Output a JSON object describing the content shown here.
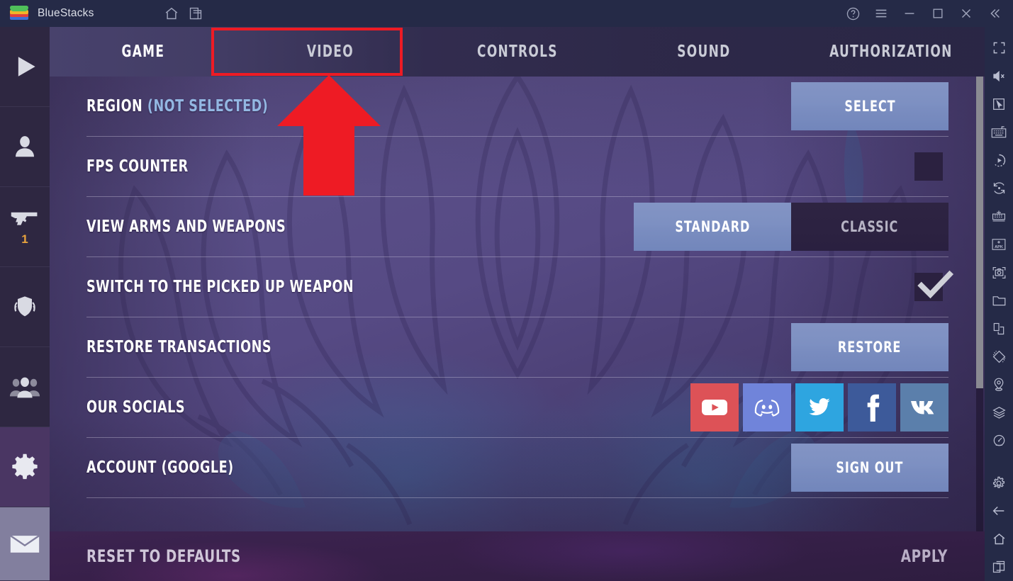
{
  "titlebar": {
    "app_name": "BlueStacks",
    "logo_icon": "bluestacks-logo",
    "left_icons": [
      {
        "name": "home-icon",
        "label": "Home"
      },
      {
        "name": "multi-instance-icon",
        "label": "Instance Manager"
      }
    ],
    "right_icons": [
      {
        "name": "help-icon",
        "label": "Help"
      },
      {
        "name": "menu-icon",
        "label": "Menu"
      },
      {
        "name": "minimize-icon",
        "label": "Minimize"
      },
      {
        "name": "maximize-icon",
        "label": "Maximize"
      },
      {
        "name": "close-icon",
        "label": "Close"
      },
      {
        "name": "collapse-icon",
        "label": "Collapse"
      }
    ]
  },
  "left_rail": {
    "items": [
      {
        "name": "play-icon",
        "label": "Play",
        "active": false,
        "badge": ""
      },
      {
        "name": "profile-icon",
        "label": "Profile",
        "active": false,
        "badge": ""
      },
      {
        "name": "weapons-icon",
        "label": "Weapons",
        "active": false,
        "badge": "1"
      },
      {
        "name": "clan-icon",
        "label": "Clan",
        "active": false,
        "badge": ""
      },
      {
        "name": "friends-icon",
        "label": "Friends",
        "active": false,
        "badge": ""
      },
      {
        "name": "settings-gear-icon",
        "label": "Settings",
        "active": true,
        "badge": ""
      },
      {
        "name": "mail-icon",
        "label": "Mail",
        "active": false,
        "badge": ""
      }
    ]
  },
  "right_rail": {
    "items": [
      {
        "name": "fullscreen-icon",
        "label": "Full screen"
      },
      {
        "name": "mute-icon",
        "label": "Mute"
      },
      {
        "name": "cursor-icon",
        "label": "Pointer"
      },
      {
        "name": "keymapping-icon",
        "label": "Game controls"
      },
      {
        "name": "macro-recorder-icon",
        "label": "Macro recorder"
      },
      {
        "name": "rotate-icon",
        "label": "Rotate"
      },
      {
        "name": "multi-instance-sync-icon",
        "label": "Multi-instance sync"
      },
      {
        "name": "install-apk-icon",
        "label": "Install APK"
      },
      {
        "name": "screenshot-icon",
        "label": "Screenshot"
      },
      {
        "name": "media-folder-icon",
        "label": "Media manager"
      },
      {
        "name": "copy-to-instance-icon",
        "label": "Copy to instance"
      },
      {
        "name": "tilt-icon",
        "label": "Tilt control"
      },
      {
        "name": "location-icon",
        "label": "Location"
      },
      {
        "name": "layers-icon",
        "label": "Layers"
      },
      {
        "name": "performance-icon",
        "label": "Performance"
      },
      {
        "name": "settings-gear-icon",
        "label": "Settings"
      },
      {
        "name": "back-arrow-icon",
        "label": "Back"
      },
      {
        "name": "home-icon",
        "label": "Home"
      },
      {
        "name": "recent-apps-icon",
        "label": "Recent apps"
      }
    ]
  },
  "tabs": [
    {
      "label": "GAME",
      "active": true,
      "highlighted": false
    },
    {
      "label": "VIDEO",
      "active": false,
      "highlighted": true
    },
    {
      "label": "CONTROLS",
      "active": false,
      "highlighted": false
    },
    {
      "label": "SOUND",
      "active": false,
      "highlighted": false
    },
    {
      "label": "AUTHORIZATION",
      "active": false,
      "highlighted": false
    }
  ],
  "settings_rows": [
    {
      "label": "REGION",
      "sublabel": " (NOT SELECTED)",
      "control": "button",
      "button_label": "SELECT"
    },
    {
      "label": "FPS COUNTER",
      "sublabel": "",
      "control": "checkbox",
      "checked": false
    },
    {
      "label": "VIEW ARMS AND WEAPONS",
      "sublabel": "",
      "control": "segmented",
      "options": [
        "STANDARD",
        "CLASSIC"
      ],
      "selected": "STANDARD"
    },
    {
      "label": "SWITCH TO THE PICKED UP WEAPON",
      "sublabel": "",
      "control": "checkbox",
      "checked": true
    },
    {
      "label": "RESTORE TRANSACTIONS",
      "sublabel": "",
      "control": "button",
      "button_label": "RESTORE"
    },
    {
      "label": "OUR SOCIALS",
      "sublabel": "",
      "control": "socials",
      "socials": [
        {
          "name": "youtube-icon",
          "label": "YouTube",
          "color": "#dd5257"
        },
        {
          "name": "discord-icon",
          "label": "Discord",
          "color": "#7084da"
        },
        {
          "name": "twitter-icon",
          "label": "Twitter",
          "color": "#2ea5e0"
        },
        {
          "name": "facebook-icon",
          "label": "Facebook",
          "color": "#3d5a9a"
        },
        {
          "name": "vk-icon",
          "label": "VK",
          "color": "#5b7fab"
        }
      ]
    },
    {
      "label": "ACCOUNT (GOOGLE)",
      "sublabel": "",
      "control": "button",
      "button_label": "SIGN OUT"
    }
  ],
  "footer": {
    "reset_label": "RESET TO DEFAULTS",
    "apply_label": "APPLY"
  },
  "annotation": {
    "arrow_color": "#ee1b24",
    "highlight_color": "#ee1b24",
    "arrow_points_to": "VIDEO"
  },
  "colors": {
    "titlebar_bg": "#252a47",
    "left_rail_bg": "#2e2741",
    "active_rail_bg": "#4a3663",
    "accent_button": "#7d90c2",
    "sublabel_blue": "#93b7e2",
    "badge_orange": "#e8a33d"
  }
}
